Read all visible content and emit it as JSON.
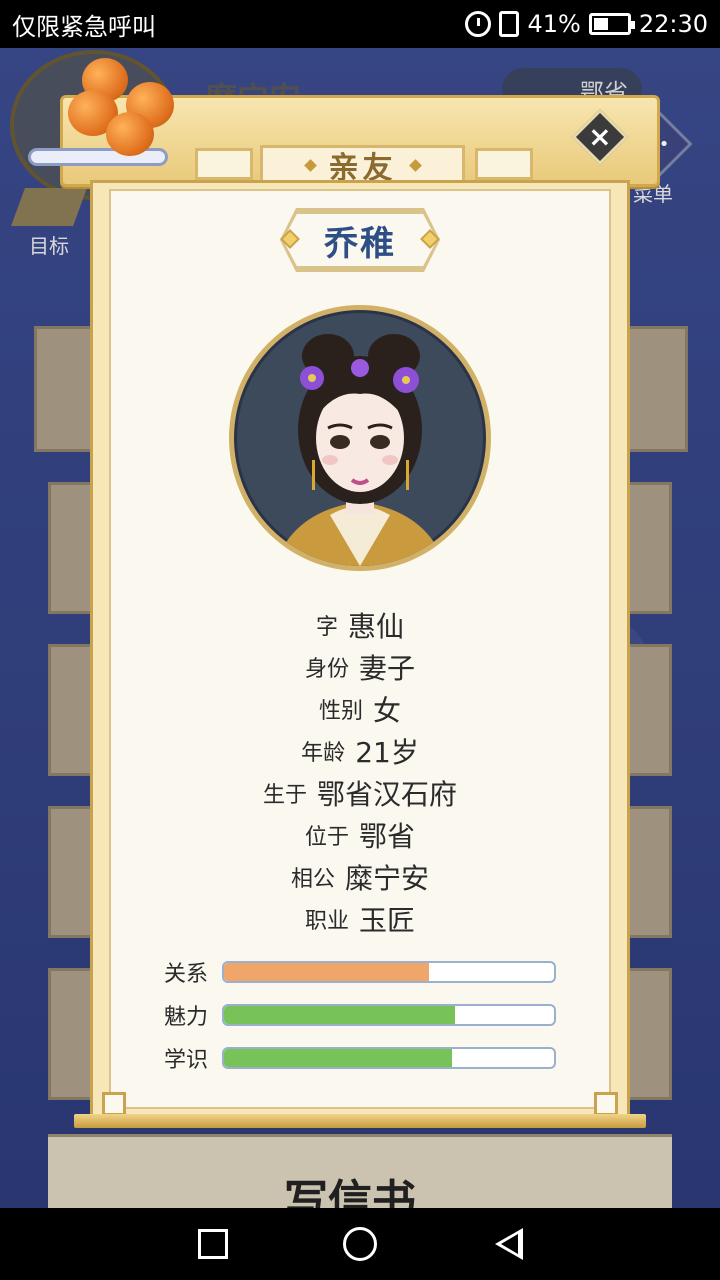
{
  "status_bar": {
    "carrier_text": "仅限紧急呼叫",
    "battery_percent": "41%",
    "time": "22:30",
    "icons": [
      "alarm-icon",
      "sim-icon",
      "battery-icon"
    ]
  },
  "background": {
    "player_name": "糜宁安",
    "province": "鄂省",
    "goal_label": "目标",
    "menu_label": "菜单",
    "bottom_button_text": "写信书"
  },
  "dialog": {
    "title": "亲友",
    "person_name": "乔稚",
    "info": [
      {
        "key": "字",
        "value": "惠仙"
      },
      {
        "key": "身份",
        "value": "妻子"
      },
      {
        "key": "性别",
        "value": "女"
      },
      {
        "key": "年龄",
        "value": "21岁"
      },
      {
        "key": "生于",
        "value": "鄂省汉石府"
      },
      {
        "key": "位于",
        "value": "鄂省"
      },
      {
        "key": "相公",
        "value": "糜宁安"
      },
      {
        "key": "职业",
        "value": "玉匠"
      }
    ],
    "stats": [
      {
        "label": "关系",
        "fraction": 0.62,
        "color": "#f0a66a"
      },
      {
        "label": "魅力",
        "fraction": 0.7,
        "color": "#77c35a"
      },
      {
        "label": "学识",
        "fraction": 0.69,
        "color": "#77c35a"
      }
    ]
  },
  "nav_bar": {
    "icons": [
      "recents-icon",
      "home-icon",
      "back-icon"
    ]
  }
}
